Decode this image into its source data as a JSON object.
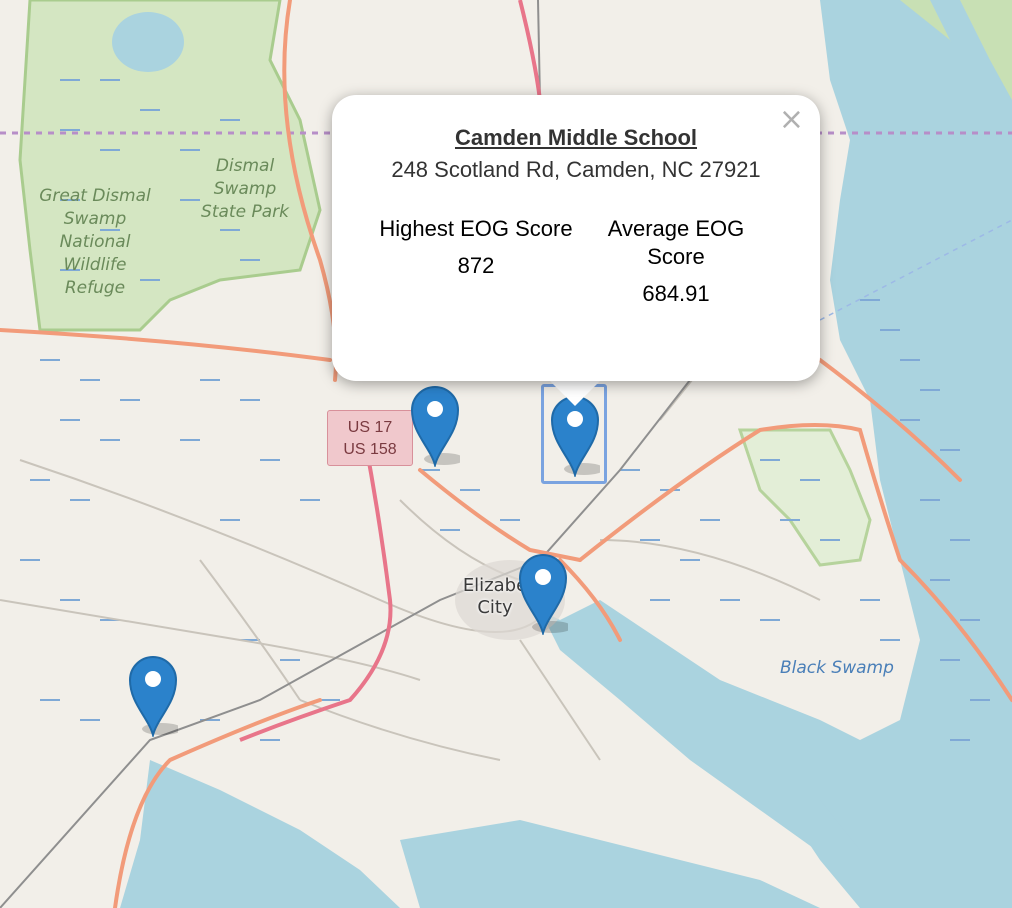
{
  "map": {
    "labels": {
      "dismal_refuge": [
        "Great Dismal",
        "Swamp",
        "National",
        "Wildlife",
        "Refuge"
      ],
      "dismal_park": [
        "Dismal",
        "Swamp",
        "State Park"
      ],
      "black_swamp": "Black Swamp",
      "city_line1": "Elizabe",
      "city_line2": "City"
    },
    "shield": {
      "line1": "US 17",
      "line2": "US 158"
    },
    "markers": [
      {
        "name": "map-marker-1"
      },
      {
        "name": "map-marker-camden"
      },
      {
        "name": "map-marker-elizabeth-city"
      },
      {
        "name": "map-marker-south-west"
      }
    ],
    "colors": {
      "land": "#f2efe9",
      "water": "#aad3df",
      "park": "#c8e0b4",
      "primary_road": "#f29b7a",
      "trunk_road": "#e8758a",
      "marker": "#2b82cb"
    }
  },
  "popup": {
    "close_label": "×",
    "title": "Camden Middle School",
    "address": "248 Scotland Rd, Camden, NC 27921",
    "stats": [
      {
        "label": "Highest EOG Score",
        "value": "872"
      },
      {
        "label": "Average EOG Score",
        "value": "684.91"
      }
    ]
  }
}
